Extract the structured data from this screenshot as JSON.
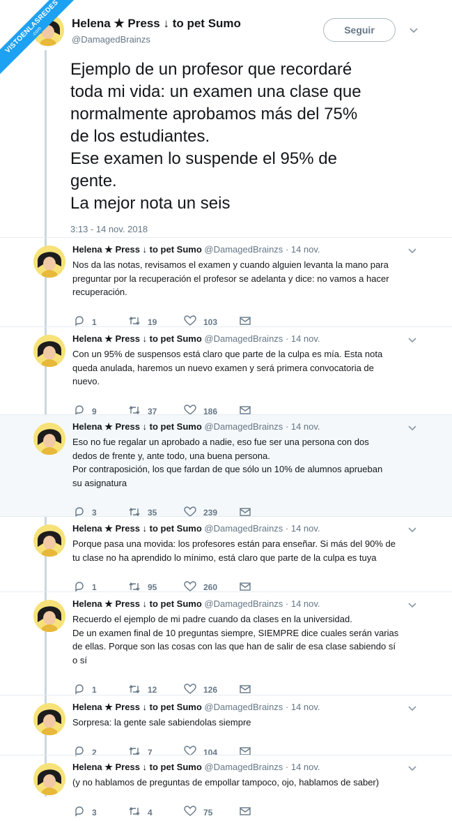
{
  "watermark": {
    "text": "VISTOENLASREDES",
    "sub": ".com"
  },
  "main": {
    "name": "Helena ★ Press ↓ to pet Sumo",
    "handle": "@DamagedBrainzs",
    "follow_label": "Seguir",
    "text_lines": [
      "Ejemplo de un profesor que recordaré",
      "toda mi vida: un examen una clase que",
      "normalmente aprobamos más del 75%",
      "de los estudiantes.",
      "Ese examen lo suspende el 95% de",
      "gente.",
      "La mejor nota un seis"
    ],
    "timestamp": "3:13 - 14 nov. 2018"
  },
  "replies": [
    {
      "name": "Helena ★ Press ↓ to pet Sumo",
      "handle": "@DamagedBrainzs · 14 nov.",
      "lines": [
        "Nos da las notas, revisamos el examen y cuando alguien levanta la mano para",
        "preguntar por la recuperación el profesor se adelanta y dice: no vamos a hacer",
        "recuperación."
      ],
      "replies": "1",
      "retweets": "19",
      "likes": "103"
    },
    {
      "name": "Helena ★ Press ↓ to pet Sumo",
      "handle": "@DamagedBrainzs · 14 nov.",
      "lines": [
        "Con un 95% de suspensos está claro que parte de la culpa es mía. Esta nota",
        "queda anulada, haremos un nuevo examen y será primera convocatoria de",
        "nuevo."
      ],
      "replies": "9",
      "retweets": "37",
      "likes": "186"
    },
    {
      "name": "Helena ★ Press ↓ to pet Sumo",
      "handle": "@DamagedBrainzs · 14 nov.",
      "lines": [
        "Eso no fue regalar un aprobado a nadie, eso fue ser una persona con dos",
        "dedos de frente y, ante todo, una buena persona.",
        "Por contraposición, los que fardan de que sólo un 10% de alumnos aprueban",
        "su asignatura"
      ],
      "replies": "3",
      "retweets": "35",
      "likes": "239"
    },
    {
      "name": "Helena ★ Press ↓ to pet Sumo",
      "handle": "@DamagedBrainzs · 14 nov.",
      "lines": [
        "Porque pasa una movida: los profesores están para enseñar. Si más del 90% de",
        "tu clase no ha aprendido lo mínimo, está claro que parte de la culpa es tuya"
      ],
      "replies": "1",
      "retweets": "95",
      "likes": "260"
    },
    {
      "name": "Helena ★ Press ↓ to pet Sumo",
      "handle": "@DamagedBrainzs · 14 nov.",
      "lines": [
        "Recuerdo el ejemplo de mi padre cuando da clases en la universidad.",
        "De un examen final de 10 preguntas siempre, SIEMPRE dice cuales serán varias",
        "de ellas. Porque son las cosas con las que han de salir de esa clase sabiendo sí",
        "o sí"
      ],
      "replies": "1",
      "retweets": "12",
      "likes": "126"
    },
    {
      "name": "Helena ★ Press ↓ to pet Sumo",
      "handle": "@DamagedBrainzs · 14 nov.",
      "lines": [
        "Sorpresa: la gente sale sabiendolas siempre"
      ],
      "replies": "2",
      "retweets": "7",
      "likes": "104"
    },
    {
      "name": "Helena ★ Press ↓ to pet Sumo",
      "handle": "@DamagedBrainzs · 14 nov.",
      "lines": [
        "(y no hablamos de preguntas de empollar tampoco, ojo, hablamos de saber)"
      ],
      "replies": "3",
      "retweets": "4",
      "likes": "75"
    }
  ],
  "icons": {
    "reply": "reply-icon",
    "retweet": "retweet-icon",
    "like": "heart-icon",
    "dm": "envelope-icon",
    "menu": "chevron-down-icon"
  },
  "colors": {
    "accent": "#1da1f2",
    "muted": "#657786",
    "text": "#14171a",
    "highlight_bg": "#f5f8fa"
  }
}
